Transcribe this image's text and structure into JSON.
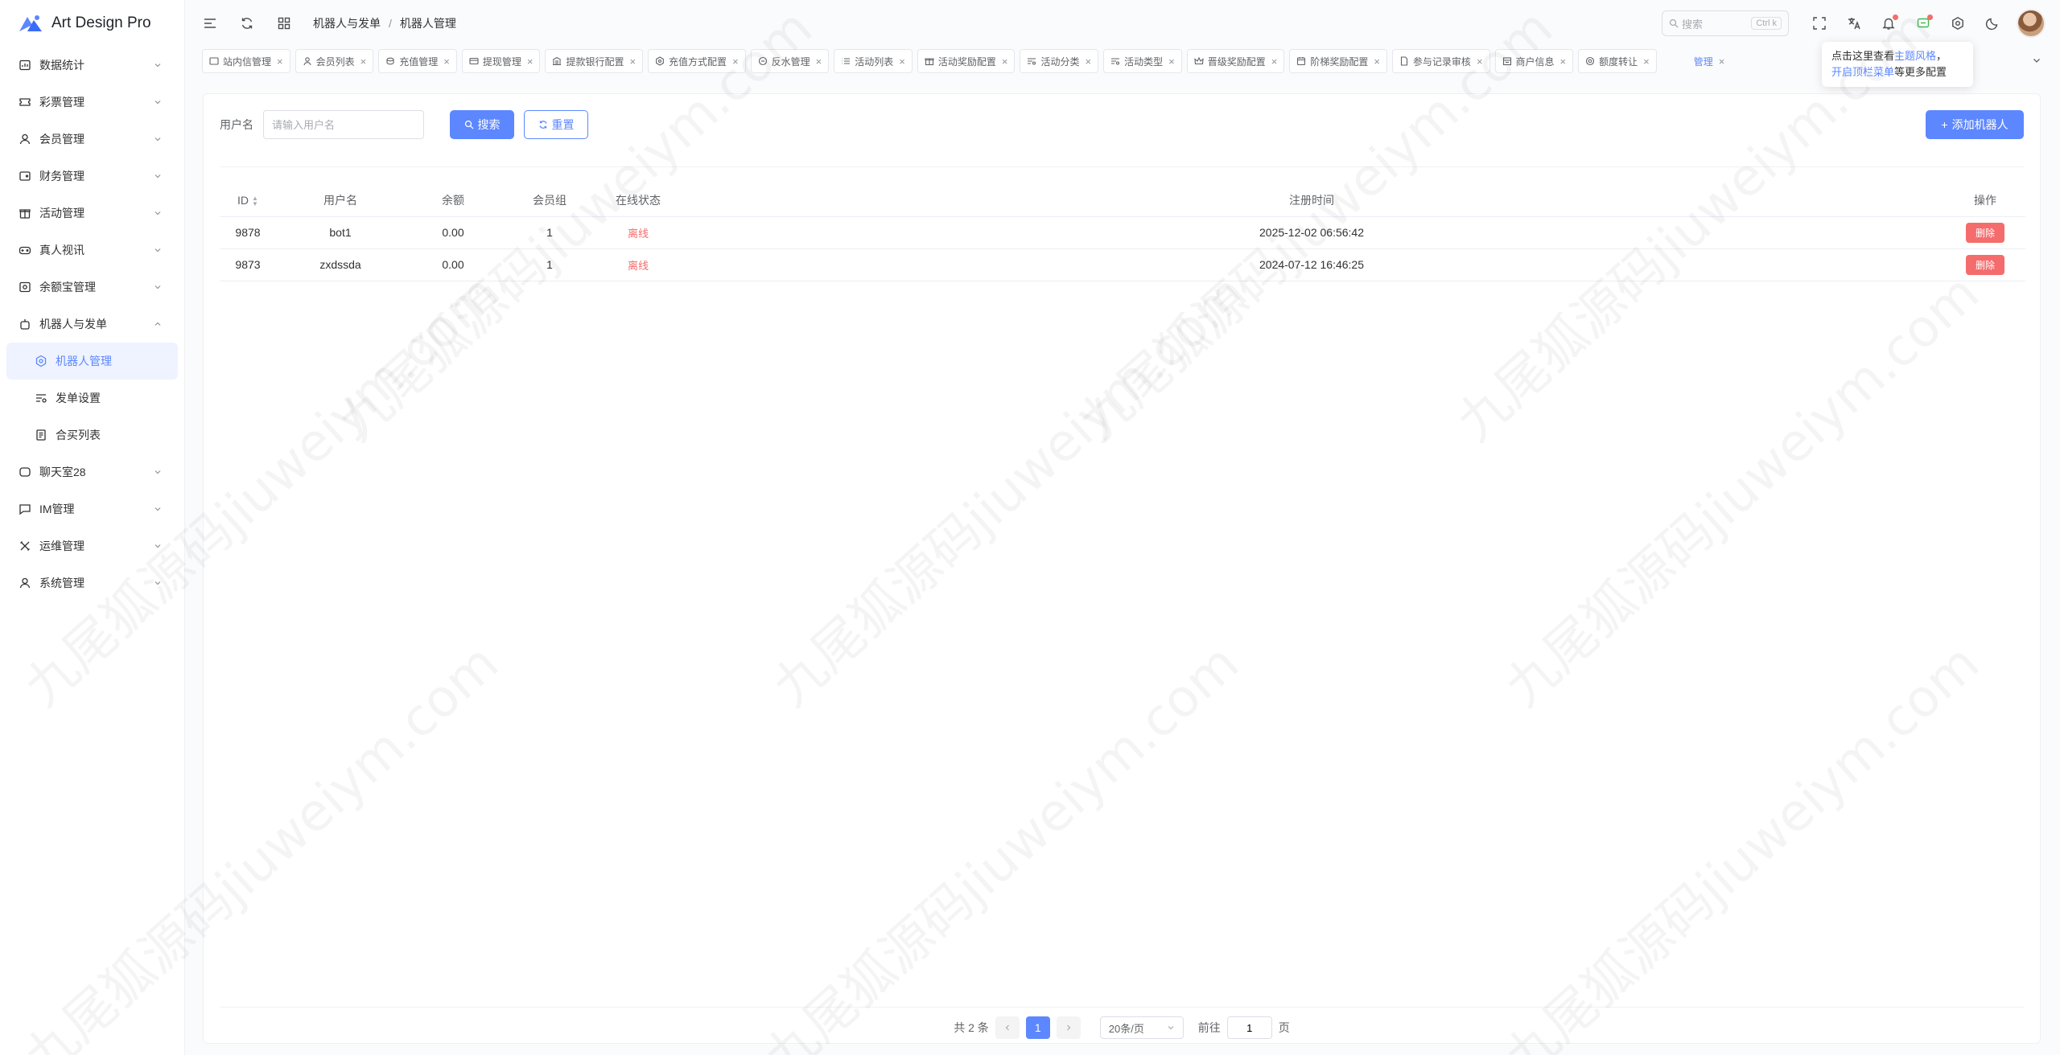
{
  "app": {
    "name": "Art Design Pro"
  },
  "sidebar": {
    "items": [
      {
        "label": "数据统计",
        "icon": "dashboard-icon"
      },
      {
        "label": "彩票管理",
        "icon": "ticket-icon"
      },
      {
        "label": "会员管理",
        "icon": "user-icon"
      },
      {
        "label": "财务管理",
        "icon": "wallet-icon"
      },
      {
        "label": "活动管理",
        "icon": "gift-icon"
      },
      {
        "label": "真人视讯",
        "icon": "gamepad-icon"
      },
      {
        "label": "余额宝管理",
        "icon": "vault-icon"
      },
      {
        "label": "机器人与发单",
        "icon": "robot-icon"
      },
      {
        "label": "聊天室28",
        "icon": "chat-icon"
      },
      {
        "label": "IM管理",
        "icon": "message-icon"
      },
      {
        "label": "运维管理",
        "icon": "tools-icon"
      },
      {
        "label": "系统管理",
        "icon": "user-cog-icon"
      }
    ],
    "subitems": [
      {
        "label": "机器人管理",
        "icon": "gear-icon"
      },
      {
        "label": "发单设置",
        "icon": "filter-list-icon"
      },
      {
        "label": "合买列表",
        "icon": "document-icon"
      }
    ]
  },
  "header": {
    "breadcrumb": [
      "机器人与发单",
      "机器人管理"
    ],
    "breadcrumb_sep": "/",
    "search_placeholder": "搜索",
    "search_shortcut": "Ctrl k"
  },
  "tabs": [
    "站内信管理",
    "会员列表",
    "充值管理",
    "提现管理",
    "提款银行配置",
    "充值方式配置",
    "反水管理",
    "活动列表",
    "活动奖励配置",
    "活动分类",
    "活动类型",
    "晋级奖励配置",
    "阶梯奖励配置",
    "参与记录审核",
    "商户信息",
    "额度转让",
    "管理"
  ],
  "tooltip": {
    "line1_prefix": "点击这里查看",
    "line1_link": "主题风格",
    "line1_suffix": "，",
    "line2_link": "开启顶栏菜单",
    "line2_suffix": "等更多配置"
  },
  "filter": {
    "label": "用户名",
    "placeholder": "请输入用户名",
    "search_label": "搜索",
    "reset_label": "重置",
    "add_label": "添加机器人"
  },
  "table": {
    "columns": [
      "ID",
      "用户名",
      "余额",
      "会员组",
      "在线状态",
      "注册时间",
      "操作"
    ],
    "rows": [
      {
        "id": "9878",
        "username": "bot1",
        "balance": "0.00",
        "group": "1",
        "status": "离线",
        "registered": "2025-12-02 06:56:42",
        "action": "删除"
      },
      {
        "id": "9873",
        "username": "zxdssda",
        "balance": "0.00",
        "group": "1",
        "status": "离线",
        "registered": "2024-07-12 16:46:25",
        "action": "删除"
      }
    ]
  },
  "pagination": {
    "total": "共 2 条",
    "current": "1",
    "page_size": "20条/页",
    "goto_label": "前往",
    "goto_value": "1",
    "page_suffix": "页"
  },
  "watermark": "九尾狐源码jiuweiym.com",
  "colors": {
    "primary": "#5d87ff",
    "danger": "#f56c6c"
  }
}
